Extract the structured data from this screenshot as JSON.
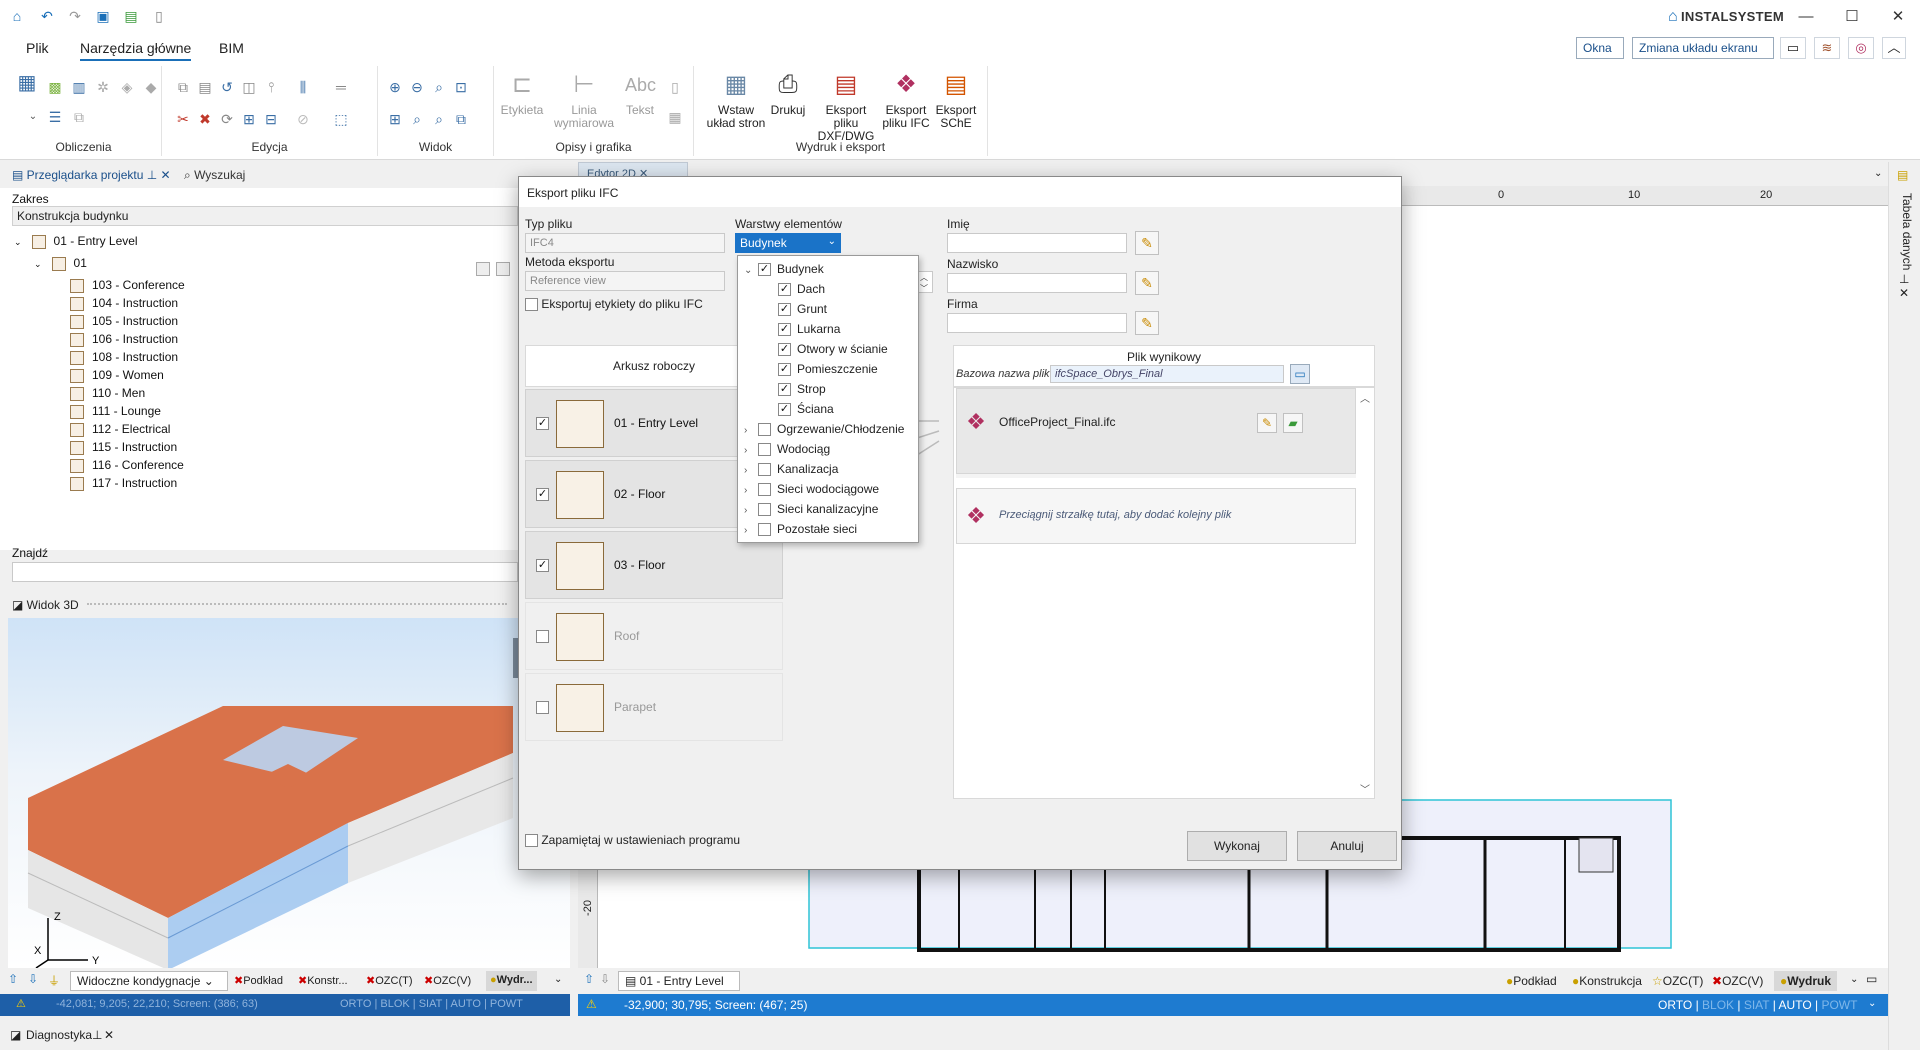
{
  "titlebar": {
    "brand": "INSTALSYSTEM",
    "minimize": "—",
    "maximize": "☐",
    "close": "✕"
  },
  "menu": {
    "tabs": [
      "Plik",
      "Narzędzia główne",
      "BIM"
    ],
    "active": "Narzędzia główne"
  },
  "topright": {
    "okna": "Okna",
    "layout": "Zmiana układu ekranu"
  },
  "ribbon": {
    "groups": [
      "Obliczenia",
      "Edycja",
      "Widok",
      "Opisy i grafika",
      "Wydruk i eksport"
    ],
    "opisy_buttons": [
      "Etykieta",
      "Linia wymiarowa",
      "Tekst"
    ],
    "wydruk": {
      "insert_pages": "Wstaw układ stron",
      "print": "Drukuj",
      "dxf": "Eksport pliku DXF/DWG",
      "ifc": "Eksport pliku IFC",
      "sche": "Eksport SChE"
    }
  },
  "left_panel": {
    "tab_browser": "Przeglądarka projektu",
    "tab_search": "Wyszukaj",
    "scope_label": "Zakres",
    "scope_value": "Konstrukcja budynku",
    "tree_root": "01 - Entry Level",
    "tree_child": "01",
    "rooms": [
      "103 - Conference",
      "104 - Instruction",
      "105 - Instruction",
      "106 - Instruction",
      "108 - Instruction",
      "109 - Women",
      "110 - Men",
      "111 - Lounge",
      "112 - Electrical",
      "115 - Instruction",
      "116 - Conference",
      "117 - Instruction"
    ],
    "find_label": "Znajdź",
    "view3d_title": "Widok 3D",
    "axes": {
      "z": "Z",
      "x": "X",
      "y": "Y"
    },
    "bottom": {
      "condition": "Widoczne kondygnacje",
      "items": [
        "Podkład",
        "Konstr...",
        "OZC(T)",
        "OZC(V)",
        "Wydr..."
      ]
    },
    "status": "-42,081; 9,205; 22,210; Screen: (386; 63)",
    "status_modes": [
      "ORTO",
      "BLOK",
      "SIAT",
      "AUTO",
      "POWT"
    ],
    "diagnostics": "Diagnostyka"
  },
  "center": {
    "tab": "Edytor 2D",
    "ruler_top": [
      "0",
      "10",
      "20"
    ],
    "ruler_left": [
      "-20"
    ],
    "level": "01 - Entry Level",
    "bottom_items": [
      "Podkład",
      "Konstrukcja",
      "OZC(T)",
      "OZC(V)",
      "Wydruk"
    ],
    "status": "-32,900; 30,795; Screen: (467; 25)",
    "status_modes": [
      "ORTO",
      "BLOK",
      "SIAT",
      "AUTO",
      "POWT"
    ]
  },
  "right_strip": {
    "label": "Tabela danych"
  },
  "dialog": {
    "title": "Eksport pliku IFC",
    "file_type_label": "Typ pliku",
    "file_type_value": "IFC4",
    "method_label": "Metoda eksportu",
    "method_value": "Reference view",
    "export_labels": "Eksportuj etykiety do pliku IFC",
    "layers_label": "Warstwy elementów",
    "layers_value": "Budynek",
    "name_label": "Imię",
    "surname_label": "Nazwisko",
    "company_label": "Firma",
    "sheets_header": "Arkusz roboczy",
    "output_header": "Plik wynikowy",
    "base_name_label": "Bazowa nazwa pliku",
    "base_name_value": "ifcSpace_Obrys_Final",
    "sheets": [
      {
        "label": "01 - Entry Level",
        "checked": true,
        "enabled": true
      },
      {
        "label": "02 - Floor",
        "checked": true,
        "enabled": true
      },
      {
        "label": "03 - Floor",
        "checked": true,
        "enabled": true
      },
      {
        "label": "Roof",
        "checked": false,
        "enabled": false
      },
      {
        "label": "Parapet",
        "checked": false,
        "enabled": false
      }
    ],
    "output_file": "OfficeProject_Final.ifc",
    "drop_hint": "Przeciągnij strzałkę tutaj, aby dodać kolejny plik",
    "remember": "Zapamiętaj w ustawieniach programu",
    "ok": "Wykonaj",
    "cancel": "Anuluj",
    "layer_tree": [
      {
        "label": "Budynek",
        "checked": true,
        "level": 0,
        "expanded": true
      },
      {
        "label": "Dach",
        "checked": true,
        "level": 1
      },
      {
        "label": "Grunt",
        "checked": true,
        "level": 1
      },
      {
        "label": "Lukarna",
        "checked": true,
        "level": 1
      },
      {
        "label": "Otwory w ścianie",
        "checked": true,
        "level": 1
      },
      {
        "label": "Pomieszczenie",
        "checked": true,
        "level": 1
      },
      {
        "label": "Strop",
        "checked": true,
        "level": 1
      },
      {
        "label": "Ściana",
        "checked": true,
        "level": 1
      },
      {
        "label": "Ogrzewanie/Chłodzenie",
        "checked": false,
        "level": 0
      },
      {
        "label": "Wodociąg",
        "checked": false,
        "level": 0
      },
      {
        "label": "Kanalizacja",
        "checked": false,
        "level": 0
      },
      {
        "label": "Sieci wodociągowe",
        "checked": false,
        "level": 0
      },
      {
        "label": "Sieci kanalizacyjne",
        "checked": false,
        "level": 0
      },
      {
        "label": "Pozostałe sieci",
        "checked": false,
        "level": 0
      }
    ]
  },
  "colors": {
    "accent": "#1a73c8",
    "status_bar": "#1e7bd0",
    "roof": "#d9724a",
    "glass": "#7fb2e8"
  }
}
